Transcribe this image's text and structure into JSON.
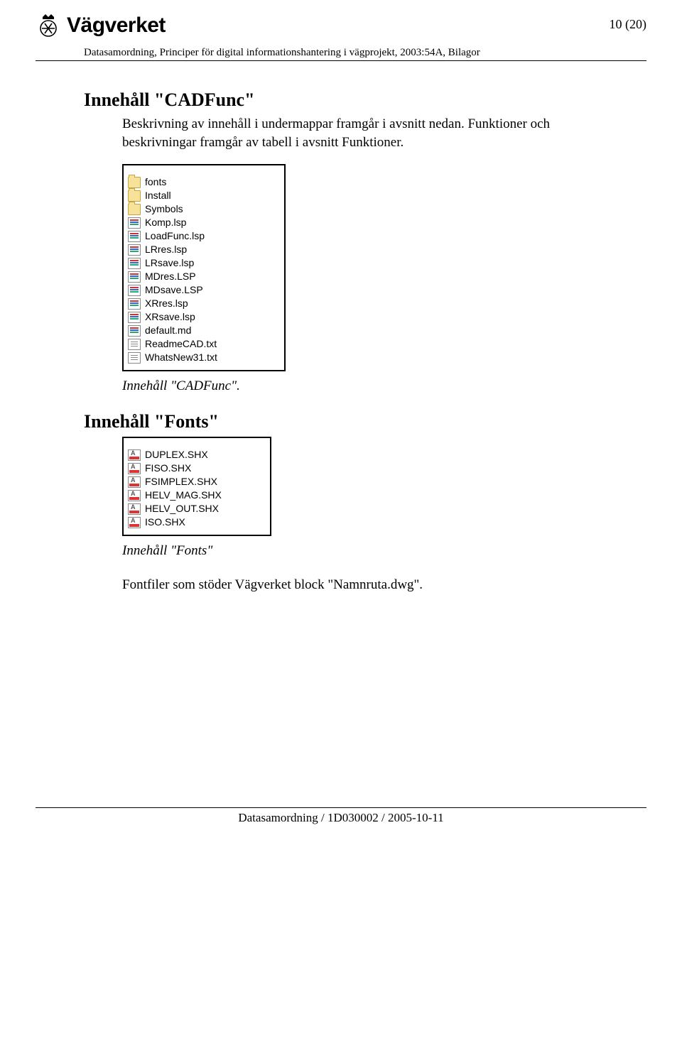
{
  "header": {
    "brand": "Vägverket",
    "page_indicator": "10 (20)",
    "breadcrumb": "Datasamordning, Principer för digital informationshantering i vägprojekt, 2003:54A, Bilagor"
  },
  "section1": {
    "title": "Innehåll \"CADFunc\"",
    "para": "Beskrivning av innehåll i undermappar framgår i avsnitt nedan. Funktioner och beskrivningar framgår av tabell i avsnitt Funktioner.",
    "files": [
      {
        "name": "fonts",
        "type": "folder"
      },
      {
        "name": "Install",
        "type": "folder"
      },
      {
        "name": "Symbols",
        "type": "folder"
      },
      {
        "name": "Komp.lsp",
        "type": "lsp"
      },
      {
        "name": "LoadFunc.lsp",
        "type": "lsp"
      },
      {
        "name": "LRres.lsp",
        "type": "lsp"
      },
      {
        "name": "LRsave.lsp",
        "type": "lsp"
      },
      {
        "name": "MDres.LSP",
        "type": "lsp"
      },
      {
        "name": "MDsave.LSP",
        "type": "lsp"
      },
      {
        "name": "XRres.lsp",
        "type": "lsp"
      },
      {
        "name": "XRsave.lsp",
        "type": "lsp"
      },
      {
        "name": "default.md",
        "type": "lsp"
      },
      {
        "name": "ReadmeCAD.txt",
        "type": "txt"
      },
      {
        "name": "WhatsNew31.txt",
        "type": "txt"
      }
    ],
    "caption": "Innehåll \"CADFunc\"."
  },
  "section2": {
    "title": "Innehåll \"Fonts\"",
    "files": [
      {
        "name": "DUPLEX.SHX",
        "type": "shx"
      },
      {
        "name": "FISO.SHX",
        "type": "shx"
      },
      {
        "name": "FSIMPLEX.SHX",
        "type": "shx"
      },
      {
        "name": "HELV_MAG.SHX",
        "type": "shx"
      },
      {
        "name": "HELV_OUT.SHX",
        "type": "shx"
      },
      {
        "name": "ISO.SHX",
        "type": "shx"
      }
    ],
    "caption": "Innehåll \"Fonts\"",
    "note": "Fontfiler som stöder Vägverket block \"Namnruta.dwg\"."
  },
  "footer": {
    "text": "Datasamordning / 1D030002 / 2005-10-11"
  }
}
